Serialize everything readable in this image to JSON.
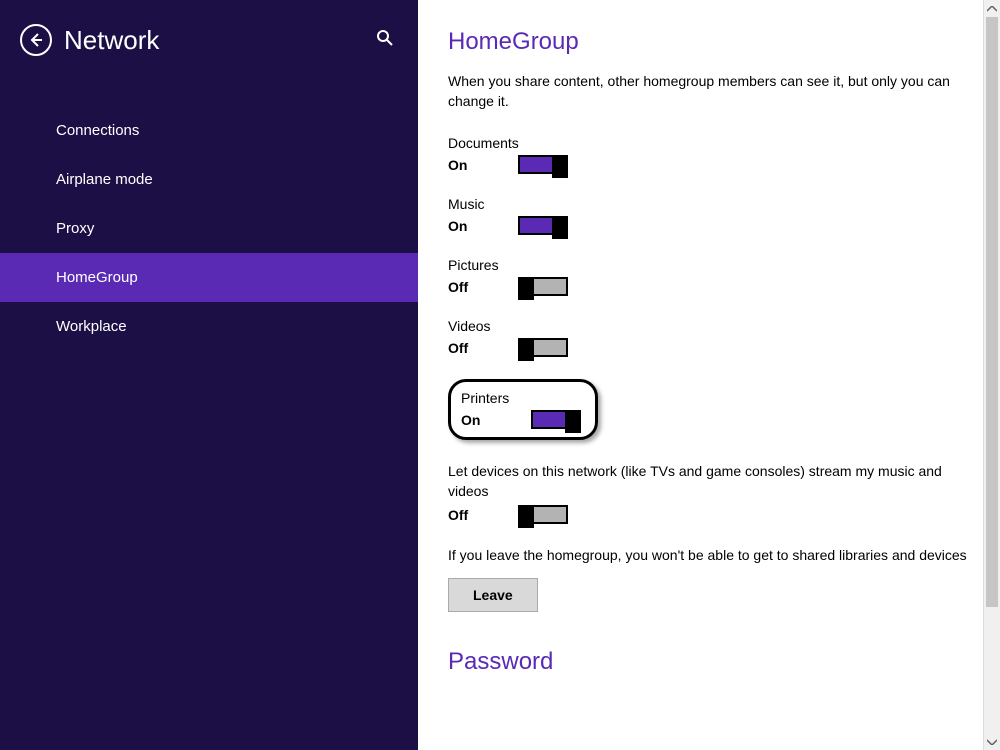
{
  "sidebar": {
    "title": "Network",
    "items": [
      {
        "label": "Connections"
      },
      {
        "label": "Airplane mode"
      },
      {
        "label": "Proxy"
      },
      {
        "label": "HomeGroup"
      },
      {
        "label": "Workplace"
      }
    ],
    "selected_index": 3
  },
  "main": {
    "section_title": "HomeGroup",
    "description": "When you share content, other homegroup members can see it, but only you can change it.",
    "settings": [
      {
        "label": "Documents",
        "state": "On",
        "on": true
      },
      {
        "label": "Music",
        "state": "On",
        "on": true
      },
      {
        "label": "Pictures",
        "state": "Off",
        "on": false
      },
      {
        "label": "Videos",
        "state": "Off",
        "on": false
      },
      {
        "label": "Printers",
        "state": "On",
        "on": true
      }
    ],
    "stream_label": "Let devices on this network (like TVs and game consoles) stream my music and videos",
    "stream_state": "Off",
    "leave_description": "If you leave the homegroup, you won't be able to get to shared libraries and devices",
    "leave_button": "Leave",
    "password_title": "Password"
  },
  "colors": {
    "sidebar_bg": "#1c0f45",
    "accent": "#5a2ab5"
  }
}
